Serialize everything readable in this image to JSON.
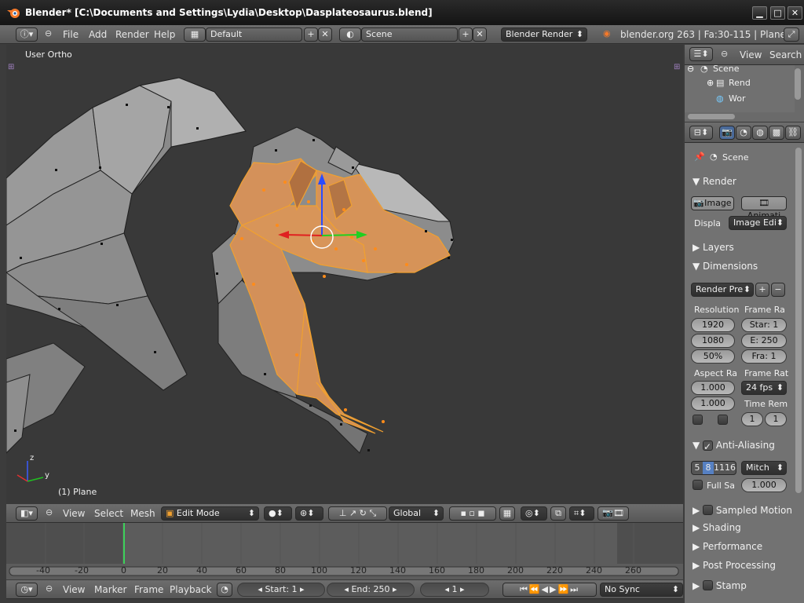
{
  "window": {
    "title": "Blender* [C:\\Documents and Settings\\Lydia\\Desktop\\Dasplateosaurus.blend]"
  },
  "info_header": {
    "menus": [
      "File",
      "Add",
      "Render",
      "Help"
    ],
    "screen_layout": "Default",
    "scene": "Scene",
    "render_engine": "Blender Render",
    "stats": "blender.org 263 | Fa:30-115 | Plane"
  },
  "viewport": {
    "view_label": "User Ortho",
    "object_label": "(1) Plane",
    "axis_y": "y",
    "axis_z": "z"
  },
  "view3d_header": {
    "menus": [
      "View",
      "Select",
      "Mesh"
    ],
    "mode": "Edit Mode",
    "orientation": "Global"
  },
  "timeline": {
    "ruler": [
      "-40",
      "-20",
      "0",
      "20",
      "40",
      "60",
      "80",
      "100",
      "120",
      "140",
      "160",
      "180",
      "200",
      "220",
      "240",
      "260"
    ],
    "current_frame_value": 0,
    "menus": [
      "View",
      "Marker",
      "Frame",
      "Playback"
    ],
    "start": "Start: 1",
    "end": "End: 250",
    "current": "1",
    "sync": "No Sync"
  },
  "outliner": {
    "menus": [
      "View",
      "Search"
    ],
    "items": [
      "Scene",
      "Rend",
      "Wor"
    ]
  },
  "properties": {
    "context": "Scene",
    "render": {
      "title": "Render",
      "image_btn": "Image",
      "anim_btn": "Animati",
      "display_label": "Displa",
      "display_value": "Image Edi"
    },
    "layers": "Layers",
    "dimensions": {
      "title": "Dimensions",
      "preset": "Render Pre",
      "resolution_label": "Resolution",
      "res_x": "1920",
      "res_y": "1080",
      "res_pct": "50%",
      "frame_range_label": "Frame Ra",
      "start": "Star: 1",
      "end": "E: 250",
      "step": "Fra: 1",
      "aspect_label": "Aspect Ra",
      "aspect_x": "1.000",
      "aspect_y": "1.000",
      "frame_rate_label": "Frame Rat",
      "fps": "24 fps",
      "time_remap_label": "Time Rem",
      "remap_old": "1",
      "remap_new": "1"
    },
    "anti_aliasing": {
      "title": "Anti-Aliasing",
      "samples": [
        "5",
        "8",
        "11",
        "16"
      ],
      "filter": "Mitch",
      "full_sample": "Full Sa",
      "filter_size": "1.000"
    },
    "sections": [
      "Sampled Motion",
      "Shading",
      "Performance",
      "Post Processing",
      "Stamp"
    ]
  },
  "colors": {
    "accent": "#f0a030",
    "selection": "#d4915a",
    "viewport_bg": "#393939"
  }
}
